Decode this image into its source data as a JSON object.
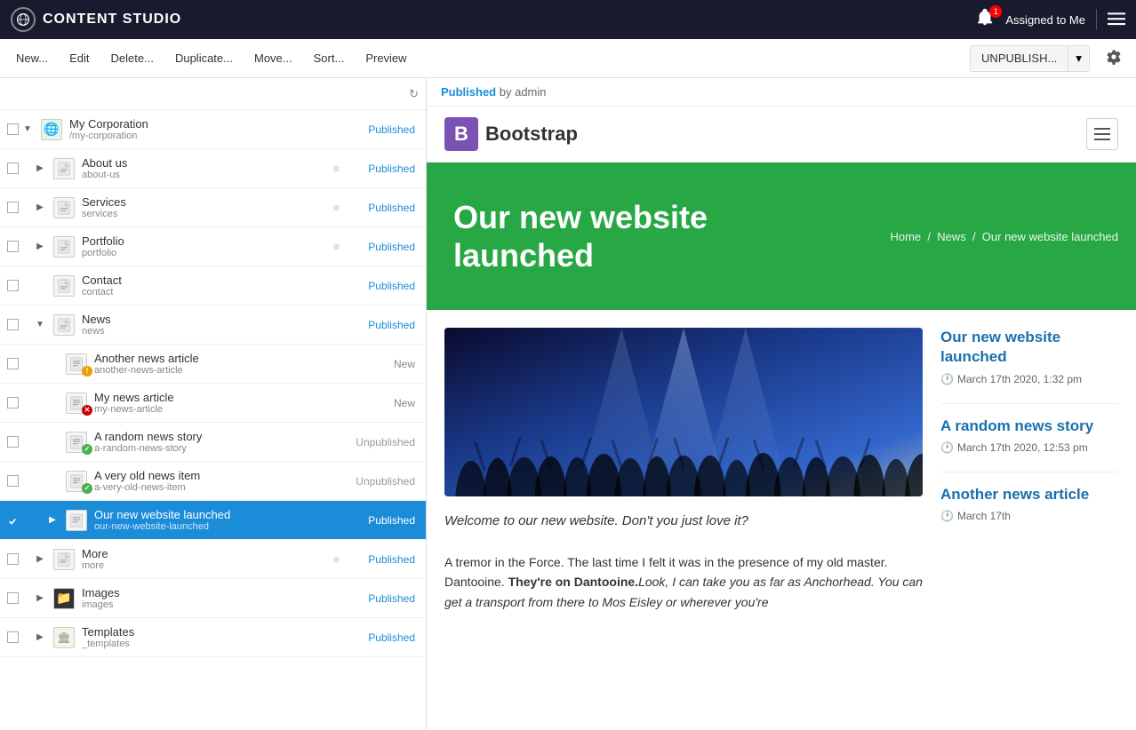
{
  "topbar": {
    "title": "CONTENT STUDIO",
    "assigned_label": "Assigned to Me",
    "notification_count": "1"
  },
  "toolbar": {
    "new_label": "New...",
    "edit_label": "Edit",
    "delete_label": "Delete...",
    "duplicate_label": "Duplicate...",
    "move_label": "Move...",
    "sort_label": "Sort...",
    "preview_label": "Preview",
    "unpublish_label": "UNPUBLISH..."
  },
  "preview": {
    "status": "Published",
    "by": "by admin",
    "nav": {
      "logo_letter": "B",
      "logo_name": "Bootstrap"
    },
    "hero": {
      "title": "Our new website launched",
      "breadcrumbs": [
        "Home",
        "News",
        "Our new website launched"
      ]
    },
    "article_italic": "Welcome to our new website. Don't you just love it?",
    "article_body": "A tremor in the Force. The last time I felt it was in the presence of my old master. Dantooine. They're on Dantooine. Look, I can take you as far as Anchorhead. You can get a transport from there to Mos Eisley or wherever you're",
    "article_body_bold": "They're on Dantooine.",
    "sidebar": {
      "articles": [
        {
          "title": "Our new website launched",
          "date": "March 17th 2020, 1:32 pm"
        },
        {
          "title": "A random news story",
          "date": "March 17th 2020, 12:53 pm"
        },
        {
          "title": "Another news article",
          "date": "March 17th"
        }
      ]
    }
  },
  "tree": {
    "items": [
      {
        "id": "my-corporation",
        "name": "My Corporation",
        "path": "/my-corporation",
        "level": 0,
        "status": "Published",
        "icon": "globe",
        "expanded": true,
        "selected": false,
        "hasCheckbox": true,
        "hasExpand": true
      },
      {
        "id": "about-us",
        "name": "About us",
        "path": "about-us",
        "level": 1,
        "status": "Published",
        "icon": "page",
        "selected": false,
        "hasCheckbox": true,
        "hasExpand": true,
        "hasDrag": true
      },
      {
        "id": "services",
        "name": "Services",
        "path": "services",
        "level": 1,
        "status": "Published",
        "icon": "page",
        "selected": false,
        "hasCheckbox": true,
        "hasExpand": true,
        "hasDrag": true
      },
      {
        "id": "portfolio",
        "name": "Portfolio",
        "path": "portfolio",
        "level": 1,
        "status": "Published",
        "icon": "page",
        "selected": false,
        "hasCheckbox": true,
        "hasExpand": true,
        "hasDrag": true
      },
      {
        "id": "contact",
        "name": "Contact",
        "path": "contact",
        "level": 1,
        "status": "Published",
        "icon": "page",
        "selected": false,
        "hasCheckbox": true
      },
      {
        "id": "news",
        "name": "News",
        "path": "news",
        "level": 1,
        "status": "Published",
        "icon": "page",
        "selected": false,
        "hasCheckbox": true,
        "hasExpand": true
      },
      {
        "id": "another-news",
        "name": "Another news article",
        "path": "another-news-article",
        "level": 2,
        "status": "New",
        "icon": "article",
        "badge": "warning",
        "selected": false,
        "hasCheckbox": true
      },
      {
        "id": "my-news",
        "name": "My news article",
        "path": "my-news-article",
        "level": 2,
        "status": "New",
        "icon": "article",
        "badge": "error",
        "selected": false,
        "hasCheckbox": true
      },
      {
        "id": "random-news",
        "name": "A random news story",
        "path": "a-random-news-story",
        "level": 2,
        "status": "Unpublished",
        "icon": "article",
        "badge": "success",
        "selected": false,
        "hasCheckbox": true
      },
      {
        "id": "old-news",
        "name": "A very old news item",
        "path": "a-very-old-news-item",
        "level": 2,
        "status": "Unpublished",
        "icon": "article",
        "badge": "success",
        "selected": false,
        "hasCheckbox": true
      },
      {
        "id": "our-new-website",
        "name": "Our new website launched",
        "path": "our-new-website-launched",
        "level": 2,
        "status": "Published",
        "icon": "article",
        "selected": true,
        "hasCheckbox": true,
        "hasExpand": true
      },
      {
        "id": "more",
        "name": "More",
        "path": "more",
        "level": 1,
        "status": "Published",
        "icon": "page",
        "selected": false,
        "hasCheckbox": true,
        "hasExpand": true,
        "hasDrag": true
      },
      {
        "id": "images",
        "name": "Images",
        "path": "images",
        "level": 1,
        "status": "Published",
        "icon": "folder",
        "selected": false,
        "hasCheckbox": true,
        "hasExpand": true
      },
      {
        "id": "templates",
        "name": "Templates",
        "path": "_templates",
        "level": 1,
        "status": "Published",
        "icon": "temple",
        "selected": false,
        "hasCheckbox": true,
        "hasExpand": true
      }
    ]
  }
}
